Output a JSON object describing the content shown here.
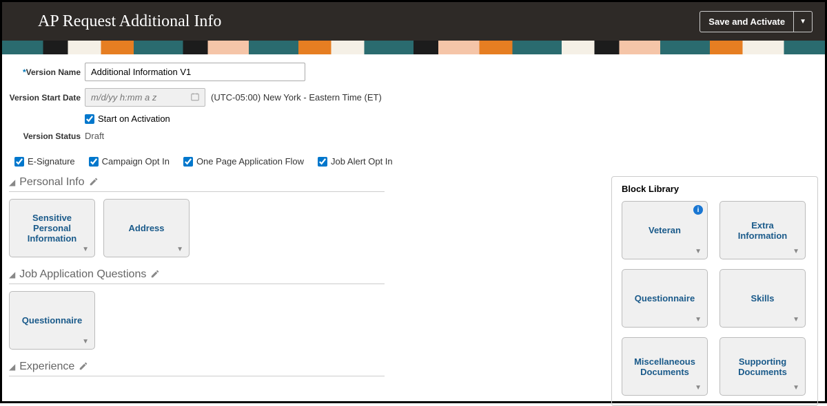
{
  "header": {
    "title": "AP Request Additional Info",
    "save_label": "Save and Activate"
  },
  "form": {
    "version_name_label": "Version Name",
    "version_name_value": "Additional Information V1",
    "version_start_label": "Version Start Date",
    "version_start_placeholder": "m/d/yy h:mm a z",
    "timezone_text": "(UTC-05:00) New York - Eastern Time (ET)",
    "start_on_activation_label": "Start on Activation",
    "version_status_label": "Version Status",
    "version_status_value": "Draft"
  },
  "options": {
    "esignature": "E-Signature",
    "campaign_opt": "Campaign Opt In",
    "one_page": "One Page Application Flow",
    "job_alert": "Job Alert Opt In"
  },
  "sections": {
    "personal": {
      "title": "Personal Info",
      "blocks": [
        {
          "label": "Sensitive Personal Information"
        },
        {
          "label": "Address"
        }
      ]
    },
    "questions": {
      "title": "Job Application Questions",
      "blocks": [
        {
          "label": "Questionnaire"
        }
      ]
    },
    "experience": {
      "title": "Experience"
    }
  },
  "library": {
    "title": "Block Library",
    "blocks": [
      {
        "label": "Veteran",
        "info": true
      },
      {
        "label": "Extra Information"
      },
      {
        "label": "Questionnaire"
      },
      {
        "label": "Skills"
      },
      {
        "label": "Miscellaneous Documents"
      },
      {
        "label": "Supporting Documents"
      }
    ]
  }
}
